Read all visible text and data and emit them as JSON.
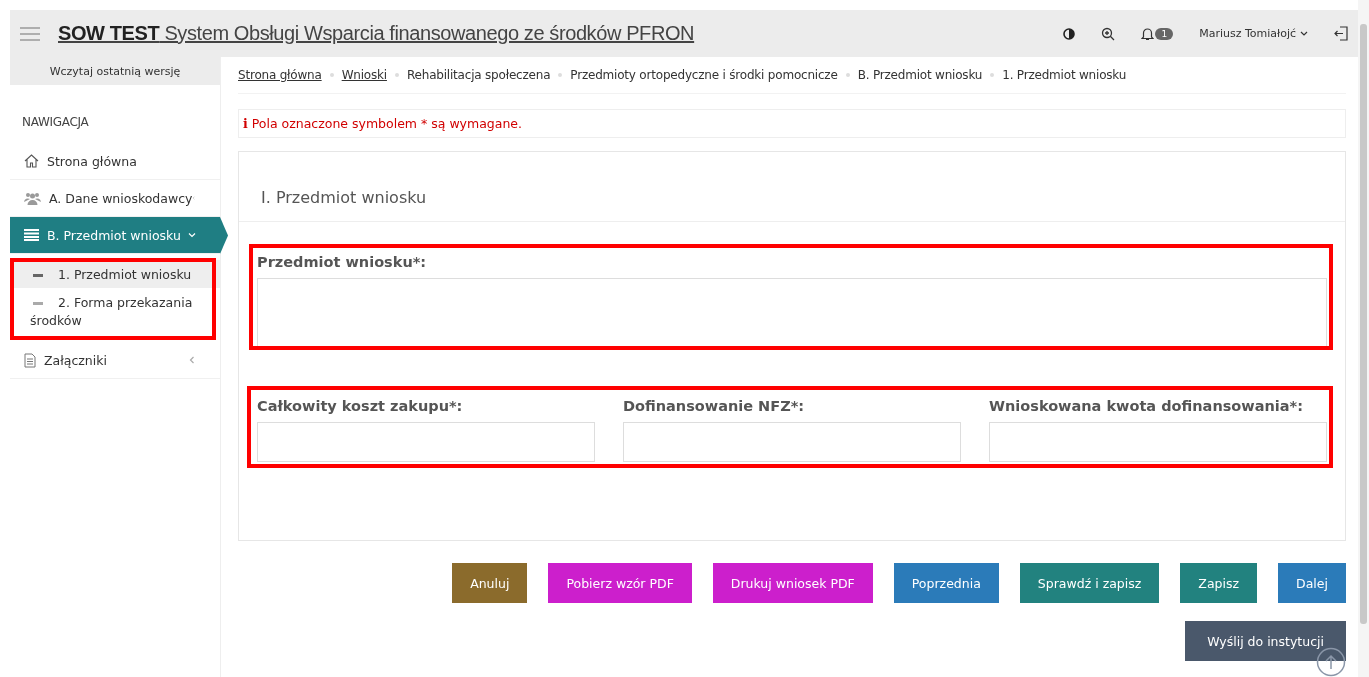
{
  "header": {
    "brand": "SOW TEST",
    "title": "System Obsługi Wsparcia finansowanego ze środków PFRON",
    "notification_count": "1",
    "user": "Mariusz Tomiałojć"
  },
  "sidebar": {
    "load_link": "Wczytaj ostatnią wersję",
    "heading": "NAWIGACJA",
    "highlighted": true,
    "items": [
      {
        "label": "Strona główna",
        "selected": false
      },
      {
        "label": "A. Dane wnioskodawcy",
        "selected": false,
        "expanded": false
      },
      {
        "label": "B. Przedmiot wniosku",
        "selected": true,
        "expanded": true,
        "children": [
          {
            "label": "1. Przedmiot wniosku",
            "selected": true
          },
          {
            "label": "2. Forma przekazania środków",
            "selected": false
          }
        ]
      },
      {
        "label": "Załączniki",
        "selected": false,
        "expanded": false
      }
    ]
  },
  "breadcrumbs": [
    {
      "label": "Strona główna",
      "link": true
    },
    {
      "label": "Wnioski",
      "link": true
    },
    {
      "label": "Rehabilitacja społeczena",
      "link": false
    },
    {
      "label": "Przedmioty ortopedyczne i środki pomocnicze",
      "link": false
    },
    {
      "label": "B. Przedmiot wniosku",
      "link": false
    },
    {
      "label": "1. Przedmiot wniosku",
      "link": false
    }
  ],
  "notice": {
    "icon": "i",
    "text": "Pola oznaczone symbolem * są wymagane."
  },
  "form": {
    "title": "I. Przedmiot wniosku",
    "groups": [
      {
        "highlighted": true,
        "fields": [
          {
            "label": "Przedmiot wniosku*:",
            "kind": "textarea"
          }
        ]
      },
      {
        "highlighted": true,
        "fields": [
          {
            "label": "Całkowity koszt zakupu*:",
            "kind": "input"
          },
          {
            "label": "Dofinansowanie NFZ*:",
            "kind": "input"
          },
          {
            "label": "Wnioskowana kwota dofinansowania*:",
            "kind": "input"
          }
        ]
      }
    ]
  },
  "buttons": [
    {
      "label": "Anuluj",
      "color": "#8b6b2c"
    },
    {
      "label": "Pobierz wzór PDF",
      "color": "#cc1fcc"
    },
    {
      "label": "Drukuj wniosek PDF",
      "color": "#cc1fcc"
    },
    {
      "label": "Poprzednia",
      "color": "#2b7bb9"
    },
    {
      "label": "Sprawdź i zapisz",
      "color": "#22827f"
    },
    {
      "label": "Zapisz",
      "color": "#22827f"
    },
    {
      "label": "Dalej",
      "color": "#2b7bb9"
    }
  ],
  "send_button": {
    "label": "Wyślij do instytucji",
    "color": "#4a586b"
  }
}
